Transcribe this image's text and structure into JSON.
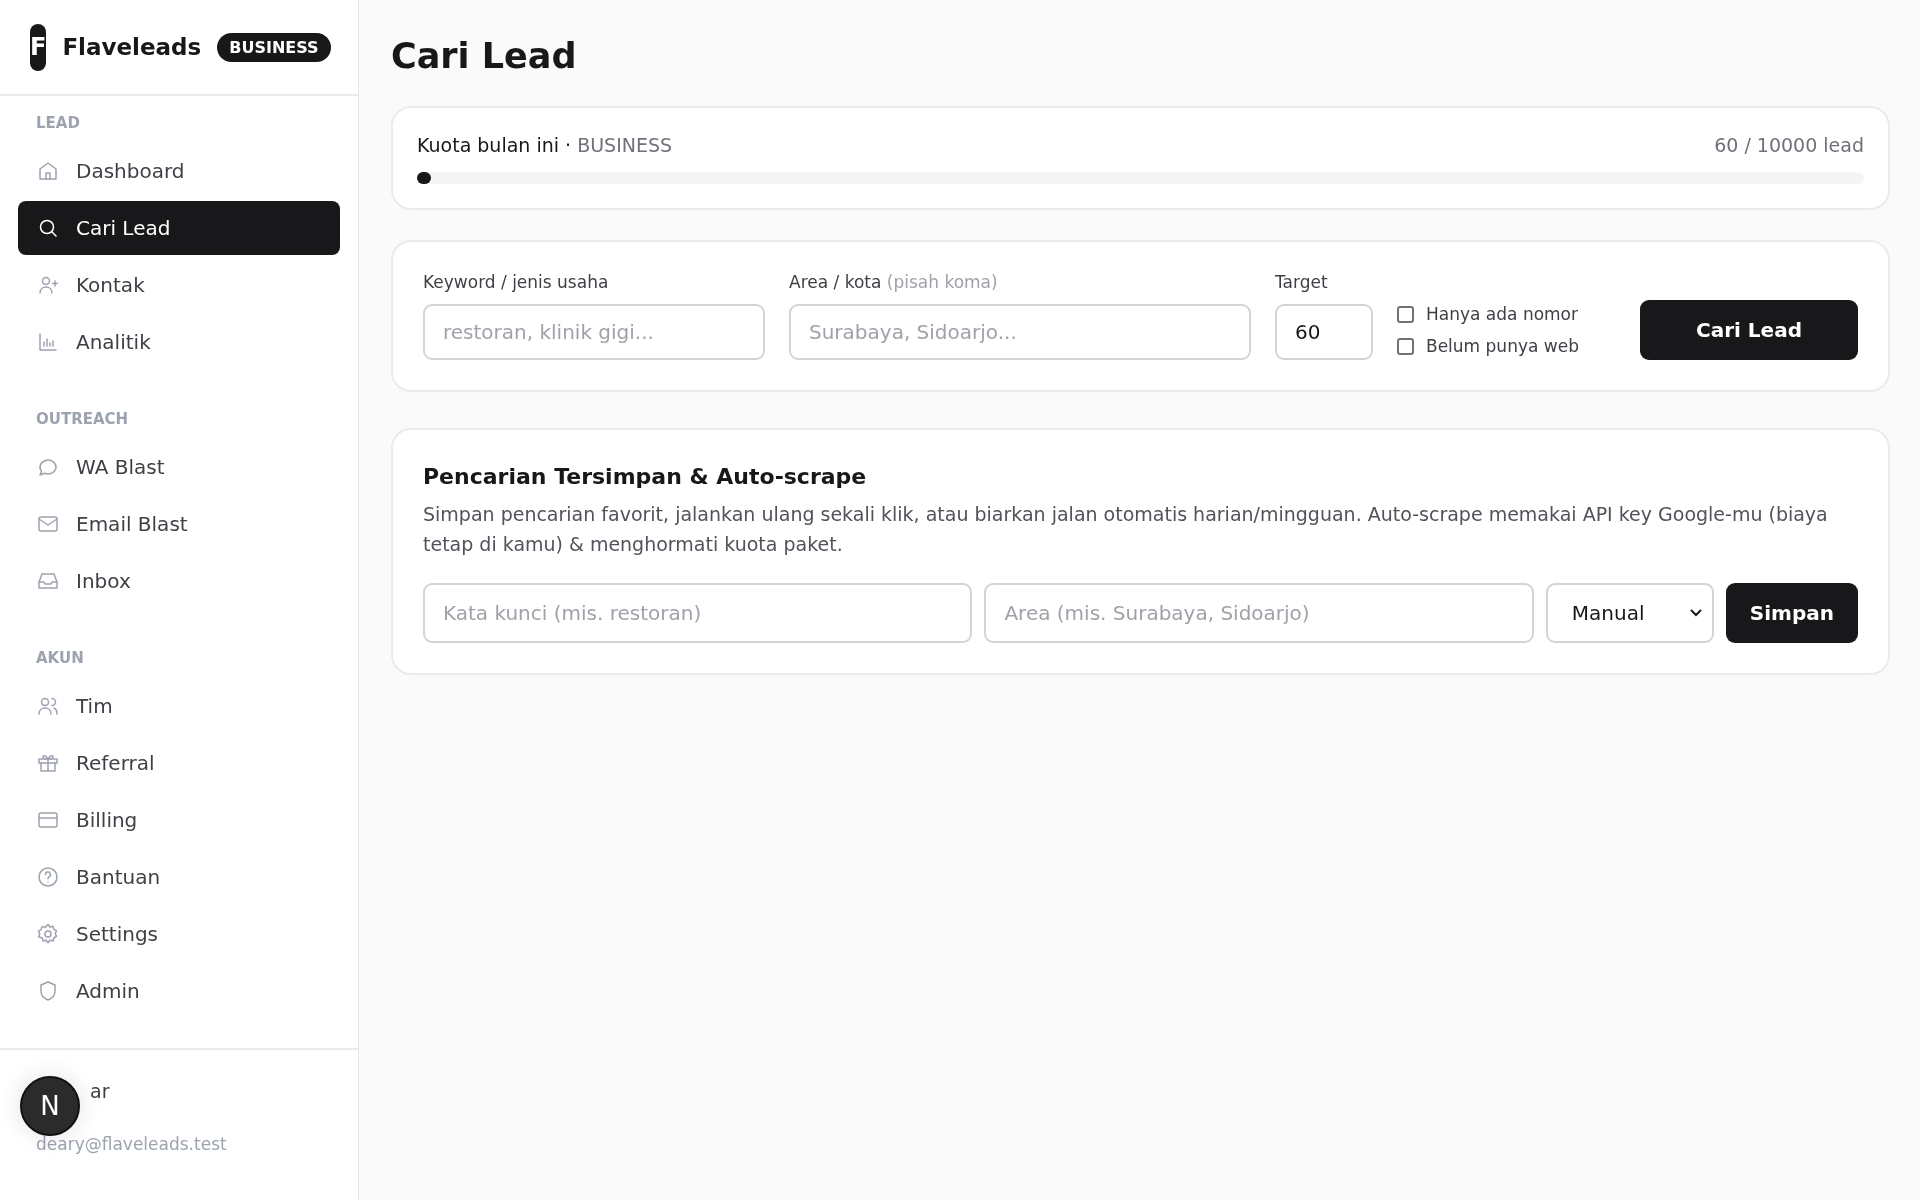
{
  "brand": {
    "logo_letter": "F",
    "name": "Flaveleads",
    "plan_badge": "BUSINESS"
  },
  "sidebar": {
    "sections": [
      {
        "title": "LEAD",
        "items": [
          {
            "label": "Dashboard",
            "selected": false
          },
          {
            "label": "Cari Lead",
            "selected": true
          },
          {
            "label": "Kontak",
            "selected": false
          },
          {
            "label": "Analitik",
            "selected": false
          }
        ]
      },
      {
        "title": "OUTREACH",
        "items": [
          {
            "label": "WA Blast",
            "selected": false
          },
          {
            "label": "Email Blast",
            "selected": false
          },
          {
            "label": "Inbox",
            "selected": false
          }
        ]
      },
      {
        "title": "AKUN",
        "items": [
          {
            "label": "Tim",
            "selected": false
          },
          {
            "label": "Referral",
            "selected": false
          },
          {
            "label": "Billing",
            "selected": false
          },
          {
            "label": "Bantuan",
            "selected": false
          },
          {
            "label": "Settings",
            "selected": false
          },
          {
            "label": "Admin",
            "selected": false
          }
        ]
      }
    ]
  },
  "user": {
    "name": "ar",
    "email": "deary@flaveleads.test",
    "avatar_letter": "N"
  },
  "page_title": "Cari Lead",
  "quota": {
    "label": "Kuota bulan ini ·",
    "plan": "BUSINESS",
    "reading": "60 / 10000 lead",
    "level": 0.006
  },
  "search_form": {
    "keyword": {
      "label": "Keyword / jenis usaha",
      "placeholder": "restoran, klinik gigi..."
    },
    "area": {
      "label": "Area / kota",
      "hint": "(pisah koma)",
      "placeholder": "Surabaya, Sidoarjo..."
    },
    "target": {
      "label": "Target",
      "value": "60"
    },
    "options": [
      {
        "label": "Hanya ada nomor",
        "checked": false
      },
      {
        "label": "Belum punya web",
        "checked": false
      }
    ],
    "button": "Cari Lead"
  },
  "saved_searches": {
    "title": "Pencarian Tersimpan & Auto-scrape",
    "description": "Simpan pencarian favorit, jalankan ulang sekali klik, atau biarkan jalan otomatis harian/mingguan. Auto-scrape memakai API key Google-mu (biaya tetap di kamu) & menghormati kuota paket.",
    "keyword_placeholder": "Kata kunci (mis. restoran)",
    "area_placeholder": "Area (mis. Surabaya, Sidoarjo)",
    "schedule": "Manual",
    "button": "Simpan"
  }
}
